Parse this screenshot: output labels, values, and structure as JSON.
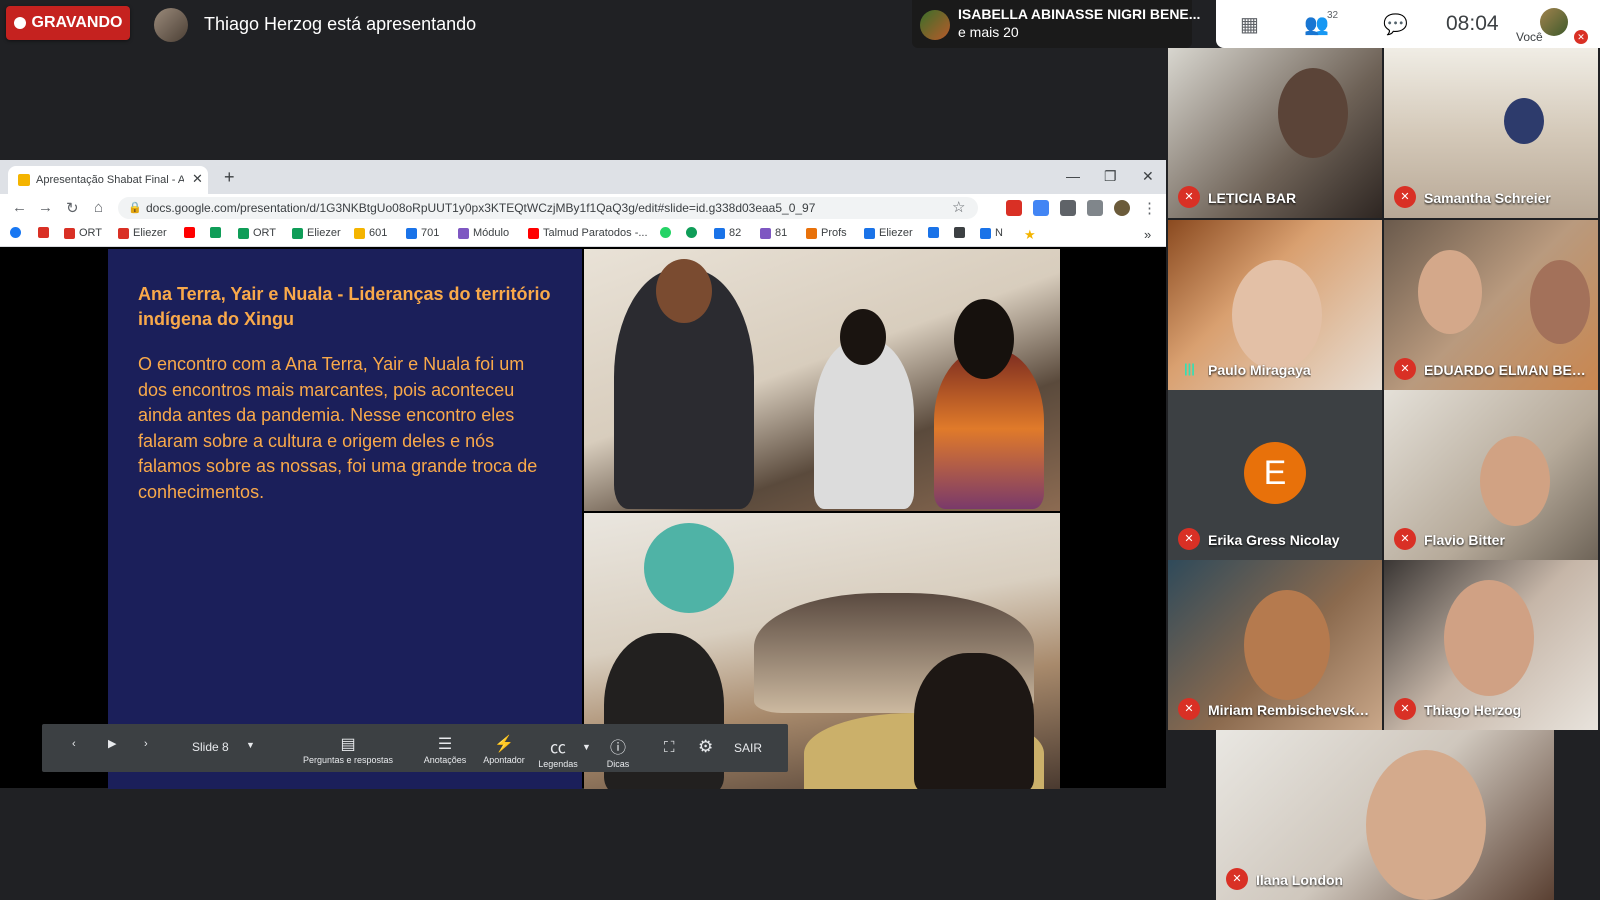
{
  "meet": {
    "recording_label": "GRAVANDO",
    "presenter_text": "Thiago Herzog está apresentando",
    "active_speaker_name": "ISABELLA ABINASSE NIGRI BENE...",
    "active_speaker_more": "e mais 20",
    "participant_count": "32",
    "time": "08:04",
    "self_label": "Você"
  },
  "browser": {
    "tab_title": "Apresentação Shabat Final - Apre",
    "url": "docs.google.com/presentation/d/1G3NKBtgUo08oRpUUT1y0px3KTEQtWCzjMBy1f1QaQ3g/edit#slide=id.g338d03eaa5_0_97",
    "bookmarks": [
      "",
      "",
      "ORT",
      "Eliezer",
      "",
      "",
      "ORT",
      "Eliezer",
      "601",
      "701",
      "Módulo",
      "Talmud Paratodos -...",
      "",
      "",
      "82",
      "81",
      "Profs",
      "Eliezer",
      "",
      "",
      "N"
    ]
  },
  "slide": {
    "title": "Ana Terra, Yair e Nuala - Lideranças do território indígena do Xingu",
    "body": "O encontro com a Ana Terra, Yair e Nuala foi um dos encontros mais marcantes, pois aconteceu ainda antes da pandemia. Nesse encontro eles falaram sobre a cultura e origem deles e nós falamos sobre as nossas, foi uma grande troca de conhecimentos."
  },
  "presenter_controls": {
    "slide_label": "Slide 8",
    "qa": "Perguntas e respostas",
    "notes": "Anotações",
    "pointer": "Apontador",
    "captions": "Legendas",
    "tips": "Dicas",
    "exit": "SAIR"
  },
  "participants": [
    {
      "name": "LETICIA BAR"
    },
    {
      "name": "Samantha Schreier"
    },
    {
      "name": "Paulo Miragaya"
    },
    {
      "name": "EDUARDO ELMAN BEIL..."
    },
    {
      "name": "Erika Gress Nicolay",
      "initial": "E"
    },
    {
      "name": "Flavio Bitter"
    },
    {
      "name": "Miriam Rembischevski ..."
    },
    {
      "name": "Thiago Herzog"
    },
    {
      "name": "Ilana London"
    }
  ],
  "colors": {
    "recording_red": "#c5221f",
    "slide_bg": "#1b1f5a",
    "slide_text": "#f9a94a",
    "avatar_orange": "#e8710a"
  }
}
